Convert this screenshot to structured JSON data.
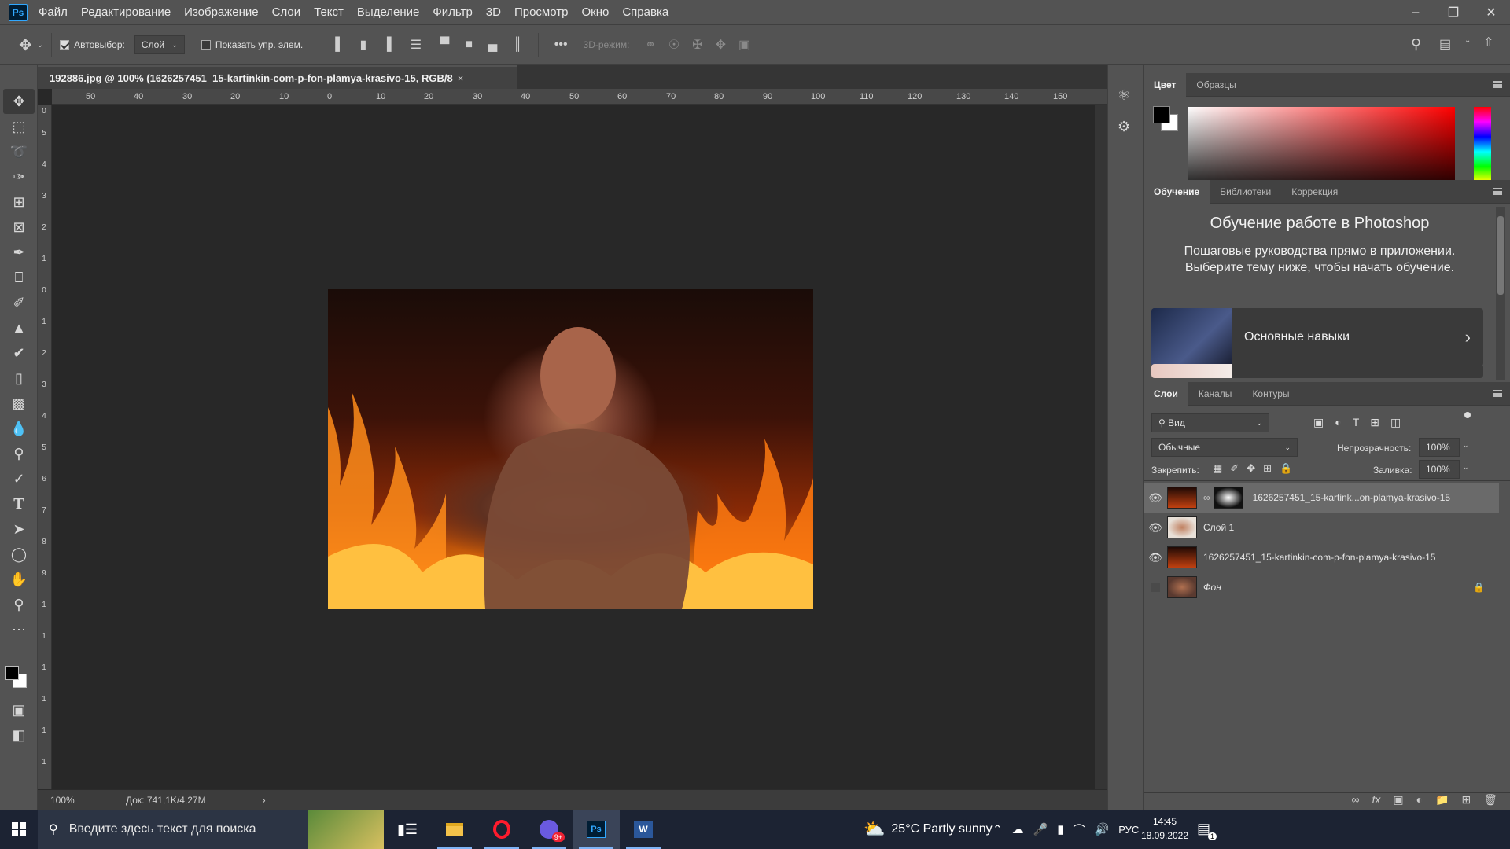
{
  "app": {
    "logo": "Ps"
  },
  "menu": [
    "Файл",
    "Редактирование",
    "Изображение",
    "Слои",
    "Текст",
    "Выделение",
    "Фильтр",
    "3D",
    "Просмотр",
    "Окно",
    "Справка"
  ],
  "options": {
    "autoselect_label": "Автовыбор:",
    "autoselect_value": "Слой",
    "show_transform_label": "Показать упр. элем.",
    "mode3d_label": "3D-режим:"
  },
  "document": {
    "tab_title": "192886.jpg @ 100% (1626257451_15-kartinkin-com-p-fon-plamya-krasivo-15, RGB/8",
    "zoom": "100%",
    "doc_info": "Док: 741,1K/4,27M"
  },
  "rulers": {
    "top": [
      "50",
      "40",
      "30",
      "20",
      "10",
      "0",
      "10",
      "20",
      "30",
      "40",
      "50",
      "60",
      "70",
      "80",
      "90",
      "100",
      "110",
      "120",
      "130",
      "140",
      "150"
    ],
    "left": [
      "0",
      "5",
      "4",
      "3",
      "2",
      "1",
      "0",
      "1",
      "2",
      "3",
      "4",
      "5",
      "6",
      "7",
      "8",
      "9",
      "1",
      "1",
      "1",
      "1",
      "1",
      "1"
    ]
  },
  "color_panel": {
    "tabs": [
      "Цвет",
      "Образцы"
    ],
    "fg": "#000000",
    "bg": "#ffffff"
  },
  "learn_panel": {
    "tabs": [
      "Обучение",
      "Библиотеки",
      "Коррекция"
    ],
    "title": "Обучение работе в Photoshop",
    "subtitle": "Пошаговые руководства прямо в приложении. Выберите тему ниже, чтобы начать обучение.",
    "card_label": "Основные навыки"
  },
  "layers_panel": {
    "tabs": [
      "Слои",
      "Каналы",
      "Контуры"
    ],
    "filter": "Вид",
    "blend_mode": "Обычные",
    "opacity_label": "Непрозрачность:",
    "opacity_value": "100%",
    "lock_label": "Закрепить:",
    "fill_label": "Заливка:",
    "fill_value": "100%",
    "layers": [
      {
        "name": "1626257451_15-kartink...on-plamya-krasivo-15",
        "visible": true,
        "selected": true
      },
      {
        "name": "Слой 1",
        "visible": true,
        "selected": false
      },
      {
        "name": "1626257451_15-kartinkin-com-p-fon-plamya-krasivo-15",
        "visible": true,
        "selected": false
      },
      {
        "name": "Фон",
        "visible": false,
        "selected": false,
        "locked": true
      }
    ]
  },
  "taskbar": {
    "search_placeholder": "Введите здесь текст для поиска",
    "weather": "25°C Partly sunny",
    "lang": "РУС",
    "time": "14:45",
    "date": "18.09.2022",
    "notif_count": "1",
    "badge": "9+"
  }
}
